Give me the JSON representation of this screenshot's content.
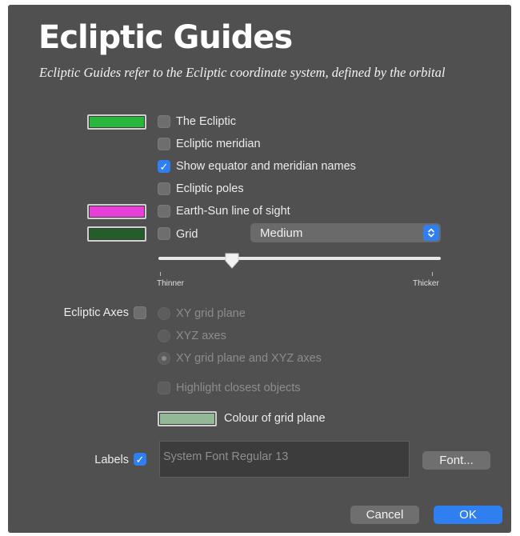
{
  "header": {
    "title": "Ecliptic Guides",
    "subtitle": "Ecliptic Guides refer to the Ecliptic coordinate system, defined by the orbital"
  },
  "colors": {
    "ecliptic": "#29b63c",
    "earth_sun_line": "#e93fd9",
    "grid": "#245c2a",
    "grid_plane": "#93b896",
    "accent": "#2f7ff0",
    "panel_background": "#505050"
  },
  "options": {
    "ecliptic": {
      "label": "The Ecliptic",
      "checked": false
    },
    "meridian": {
      "label": "Ecliptic meridian",
      "checked": false
    },
    "names": {
      "label": "Show equator and meridian names",
      "checked": true
    },
    "poles": {
      "label": "Ecliptic poles",
      "checked": false
    },
    "earth_sun": {
      "label": "Earth-Sun line of sight",
      "checked": false
    },
    "grid": {
      "label": "Grid",
      "checked": false
    }
  },
  "grid_select": {
    "value": "Medium"
  },
  "thickness_slider": {
    "min_label": "Thinner",
    "max_label": "Thicker",
    "value_fraction": 0.26
  },
  "axes": {
    "label": "Ecliptic Axes",
    "checked": false,
    "choices": [
      {
        "label": "XY grid plane",
        "selected": false
      },
      {
        "label": "XYZ axes",
        "selected": false
      },
      {
        "label": "XY grid plane and XYZ axes",
        "selected": true
      }
    ],
    "highlight_label": "Highlight closest objects",
    "grid_plane_color_label": "Colour of grid plane"
  },
  "labels": {
    "label": "Labels",
    "checked": true,
    "font_value": "System Font Regular 13",
    "font_button": "Font..."
  },
  "buttons": {
    "cancel": "Cancel",
    "ok": "OK"
  },
  "icons": {
    "checkmark": "checkmark-icon",
    "stepper": "chevron-updown-icon"
  }
}
